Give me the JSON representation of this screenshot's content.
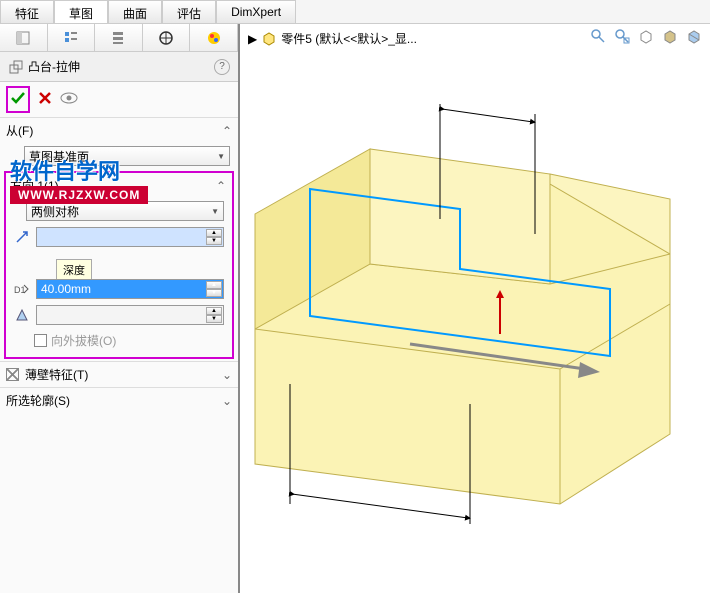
{
  "tabs": [
    "特征",
    "草图",
    "曲面",
    "评估",
    "DimXpert"
  ],
  "feature": {
    "title": "凸台-拉伸"
  },
  "from": {
    "label": "从(F)",
    "plane": "草图基准面"
  },
  "direction": {
    "label": "方向 1(1)",
    "end_condition": "两侧对称",
    "depth_value": "40.00mm",
    "depth_tooltip": "深度",
    "draft_outward": "向外拔模(O)"
  },
  "thin": {
    "label": "薄壁特征(T)"
  },
  "contour": {
    "label": "所选轮廓(S)"
  },
  "breadcrumb": {
    "part": "零件5 (默认<<默认>_显..."
  },
  "watermark": {
    "text": "软件自学网",
    "url": "WWW.RJZXW.COM"
  }
}
